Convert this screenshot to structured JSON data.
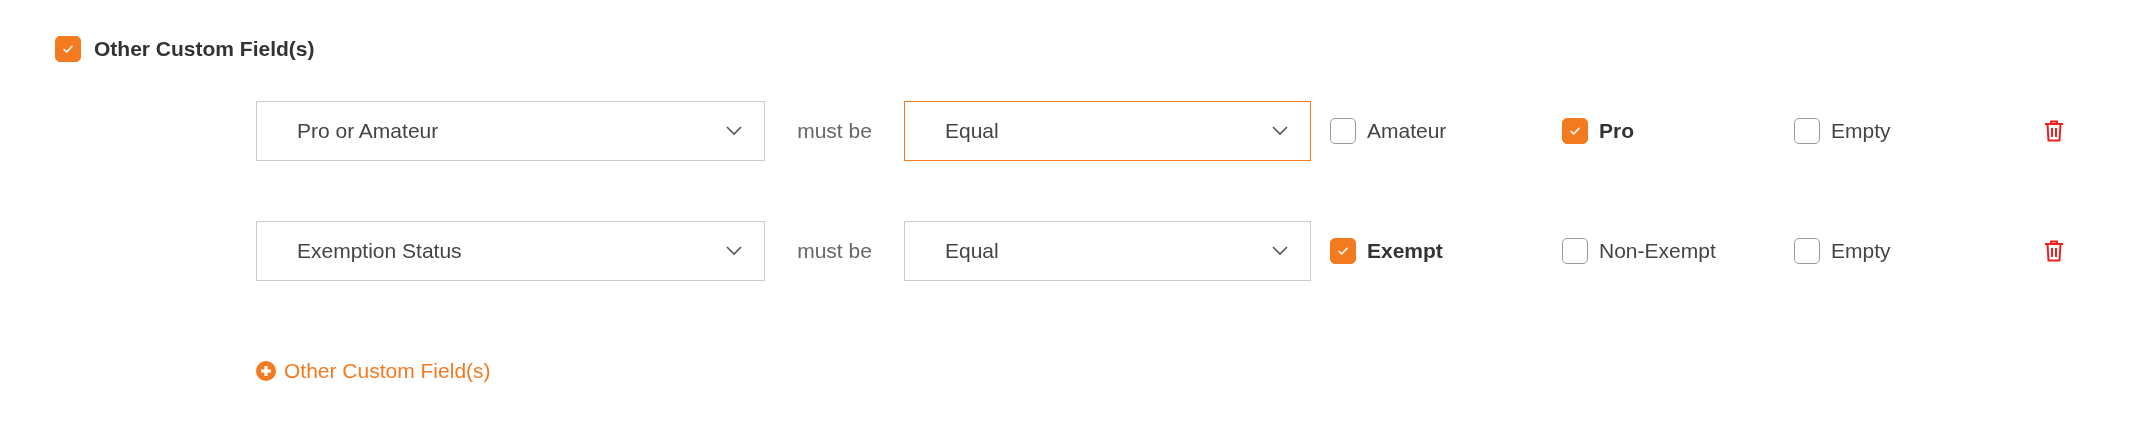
{
  "section": {
    "label": "Other Custom Field(s)",
    "checked": true
  },
  "rules": [
    {
      "field": {
        "value": "Pro or Amateur",
        "focused": false
      },
      "connector": "must be",
      "operator": {
        "value": "Equal",
        "focused": true
      },
      "options": [
        {
          "label": "Amateur",
          "checked": false
        },
        {
          "label": "Pro",
          "checked": true
        },
        {
          "label": "Empty",
          "checked": false
        }
      ]
    },
    {
      "field": {
        "value": "Exemption Status",
        "focused": false
      },
      "connector": "must be",
      "operator": {
        "value": "Equal",
        "focused": false
      },
      "options": [
        {
          "label": "Exempt",
          "checked": true
        },
        {
          "label": "Non-Exempt",
          "checked": false
        },
        {
          "label": "Empty",
          "checked": false
        }
      ]
    }
  ],
  "add_link": "Other Custom Field(s)"
}
